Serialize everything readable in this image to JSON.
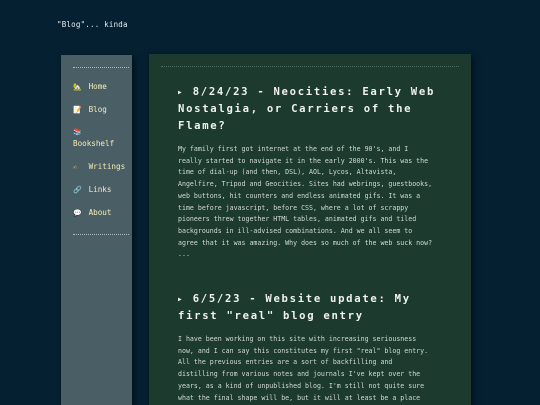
{
  "site": {
    "title": "\"Blog\"... kinda"
  },
  "sidebar": {
    "items": [
      {
        "icon": "house-icon",
        "glyph": "🏡",
        "label": "Home"
      },
      {
        "icon": "memo-icon",
        "glyph": "📝",
        "label": "Blog"
      },
      {
        "icon": "books-icon",
        "glyph": "📚",
        "label": "Bookshelf"
      },
      {
        "icon": "writing-hand-icon",
        "glyph": "✍",
        "label": "Writings"
      },
      {
        "icon": "link-icon",
        "glyph": "🔗",
        "label": "Links"
      },
      {
        "icon": "speech-bubble-icon",
        "glyph": "💬",
        "label": "About"
      }
    ]
  },
  "posts": [
    {
      "marker": "▶",
      "title_lines": [
        "8/24/23 - Neocities: Early Web",
        "Nostalgia, or Carriers of the",
        "Flame?"
      ],
      "body_lines": [
        "My family first got internet at the end of the 90's, and I",
        "really started to navigate it in the early 2000's. This was the",
        "time of dial-up (and then, DSL), AOL, Lycos, Altavista,",
        "Angelfire, Tripod and Geocities. Sites had webrings, guestbooks,",
        "web buttons, hit counters and endless animated gifs. It was a",
        "time before javascript, before CSS, where a lot of scrappy",
        "pioneers threw together HTML tables, animated gifs and tiled",
        "backgrounds in ill-advised combinations. And we all seem to",
        "agree that it was amazing. Why does so much of the web suck now?",
        "..."
      ]
    },
    {
      "marker": "▶",
      "title_lines": [
        "6/5/23 - Website update: My",
        "first \"real\" blog entry"
      ],
      "body_lines": [
        "I have been working on this site with increasing seriousness",
        "now, and I can say this constitutes my first \"real\" blog entry.",
        "All the previous entries are a sort of backfilling and",
        "distilling from various notes and journals I've kept over the",
        "years, as a kind of unpublished blog. I'm still not quite sure",
        "what the final shape will be, but it will at least be a place"
      ]
    }
  ]
}
